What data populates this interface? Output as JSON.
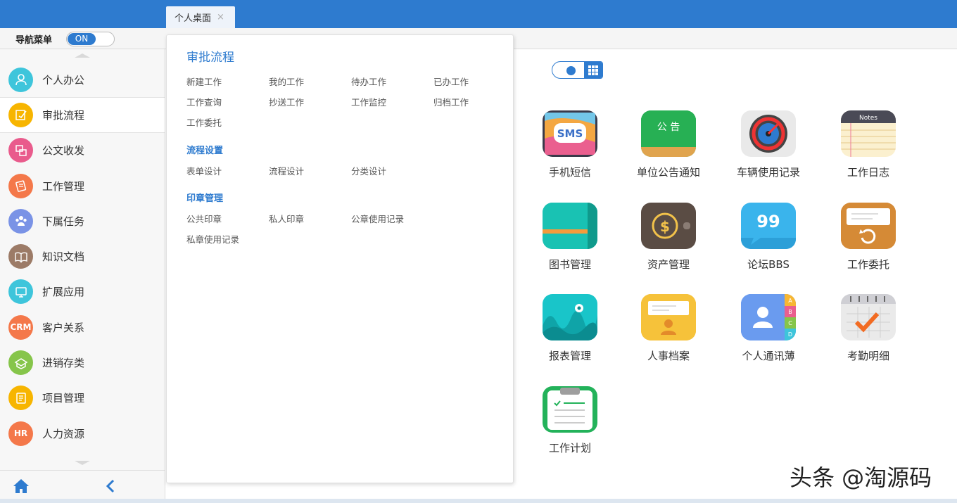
{
  "tab": {
    "label": "个人桌面",
    "close": "×"
  },
  "navbar": {
    "label": "导航菜单",
    "toggle": "ON"
  },
  "sidebar": {
    "items": [
      {
        "label": "个人办公",
        "color": "#3ec5db",
        "icon": "user-icon"
      },
      {
        "label": "审批流程",
        "color": "#f7b500",
        "icon": "approval-icon"
      },
      {
        "label": "公文收发",
        "color": "#e95b8c",
        "icon": "document-exchange-icon"
      },
      {
        "label": "工作管理",
        "color": "#f4784a",
        "icon": "work-icon"
      },
      {
        "label": "下属任务",
        "color": "#7a93e6",
        "icon": "team-icon"
      },
      {
        "label": "知识文档",
        "color": "#9c7b67",
        "icon": "book-icon"
      },
      {
        "label": "扩展应用",
        "color": "#3ec5db",
        "icon": "extension-icon"
      },
      {
        "label": "客户关系",
        "color": "#f4784a",
        "icon": "crm-icon",
        "text": "CRM"
      },
      {
        "label": "进销存类",
        "color": "#86c54a",
        "icon": "inventory-icon"
      },
      {
        "label": "项目管理",
        "color": "#f7b500",
        "icon": "project-icon"
      },
      {
        "label": "人力资源",
        "color": "#f4784a",
        "icon": "hr-icon",
        "text": "HR"
      }
    ]
  },
  "panel": {
    "title": "审批流程",
    "approval_links": [
      "新建工作",
      "我的工作",
      "待办工作",
      "已办工作",
      "工作查询",
      "抄送工作",
      "工作监控",
      "归档工作",
      "工作委托"
    ],
    "flow_settings": {
      "title": "流程设置",
      "links": [
        "表单设计",
        "流程设计",
        "分类设计"
      ]
    },
    "seal_management": {
      "title": "印章管理",
      "links": [
        "公共印章",
        "私人印章",
        "公章使用记录",
        "私章使用记录"
      ]
    }
  },
  "apps": [
    {
      "label": "手机短信",
      "icon": "sms-icon",
      "text": "SMS"
    },
    {
      "label": "单位公告通知",
      "icon": "announcement-icon",
      "text": "公 告"
    },
    {
      "label": "车辆使用记录",
      "icon": "speedometer-icon"
    },
    {
      "label": "工作日志",
      "icon": "notes-icon",
      "text": "Notes"
    },
    {
      "label": "图书管理",
      "icon": "book-management-icon"
    },
    {
      "label": "资产管理",
      "icon": "wallet-icon",
      "text": "$"
    },
    {
      "label": "论坛BBS",
      "icon": "quote-bubble-icon",
      "text": "99"
    },
    {
      "label": "工作委托",
      "icon": "delegate-icon"
    },
    {
      "label": "报表管理",
      "icon": "report-chart-icon"
    },
    {
      "label": "人事档案",
      "icon": "personnel-file-icon"
    },
    {
      "label": "个人通讯薄",
      "icon": "contacts-icon",
      "tabs": [
        "A",
        "B",
        "C",
        "D"
      ]
    },
    {
      "label": "考勤明细",
      "icon": "attendance-icon"
    },
    {
      "label": "工作计划",
      "icon": "plan-checklist-icon"
    }
  ],
  "watermark": "头条 @淘源码"
}
